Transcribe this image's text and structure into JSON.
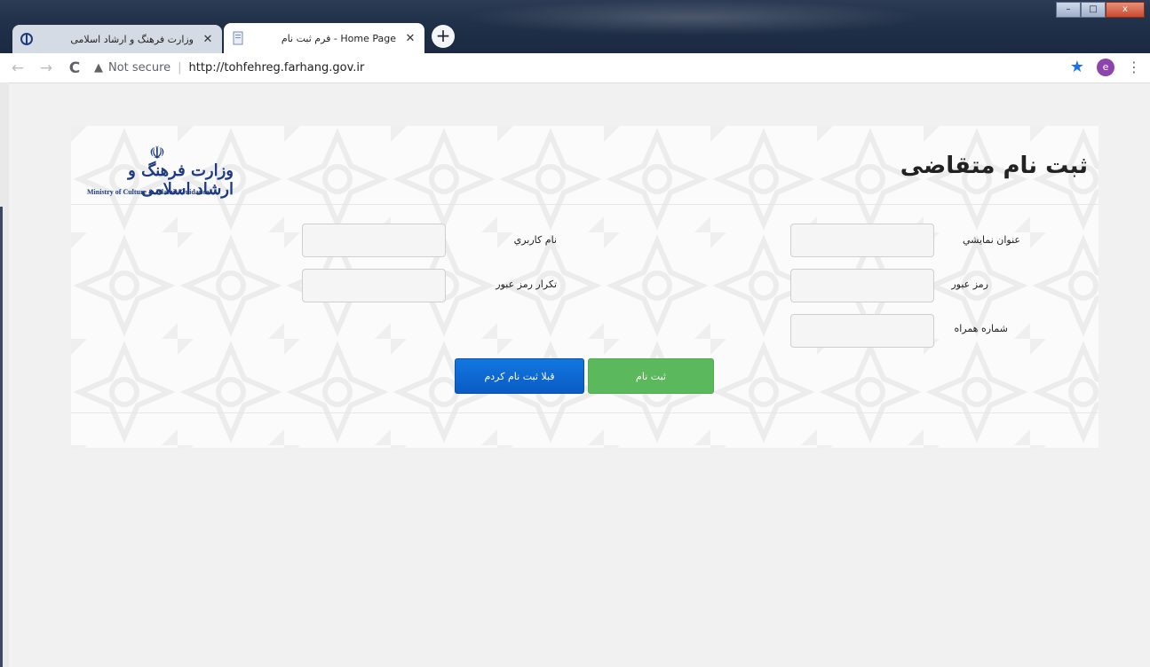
{
  "browser": {
    "tabs": [
      {
        "title": "وزارت فرهنگ و ارشاد اسلامی",
        "favicon": "emblem-icon"
      },
      {
        "title": "فرم ثبت نام - Home Page",
        "favicon": "document-icon",
        "active": true
      }
    ],
    "new_tab_symbol": "+",
    "close_symbol": "✕",
    "back_symbol": "←",
    "forward_symbol": "→",
    "reload_symbol": "C",
    "security_symbol": "▲",
    "security_text": "Not secure",
    "address_sep": "|",
    "url": "http://tohfehreg.farhang.gov.ir",
    "bookmark_symbol": "★",
    "profile_initial": "e",
    "menu_symbol": "⋮",
    "window_controls": {
      "minimize": "–",
      "maximize": "□",
      "close": "x"
    }
  },
  "page": {
    "title": "ثبت نام متقاضی",
    "logo": {
      "emblem": "☫",
      "name_fa": "وزارت فرهنگ و ارشاد اسلامی",
      "name_en": "Ministry of Culture & Islamic Guidance"
    },
    "fields": {
      "display_title": {
        "label": "عنوان نمايشي",
        "value": ""
      },
      "username": {
        "label": "نام كاربري",
        "value": ""
      },
      "password": {
        "label": "رمز عبور",
        "value": ""
      },
      "password_repeat": {
        "label": "تكرار رمز عبور",
        "value": ""
      },
      "mobile": {
        "label": "شماره همراه",
        "value": ""
      }
    },
    "buttons": {
      "register": "ثبت نام",
      "already_registered": "قبلا ثبت نام کردم"
    }
  },
  "colors": {
    "register_button": "#5cb85c",
    "already_button": "#0b5bc4",
    "logo": "#1d3b83",
    "bookmark_star": "#1a73e8",
    "profile": "#8e44ad"
  }
}
